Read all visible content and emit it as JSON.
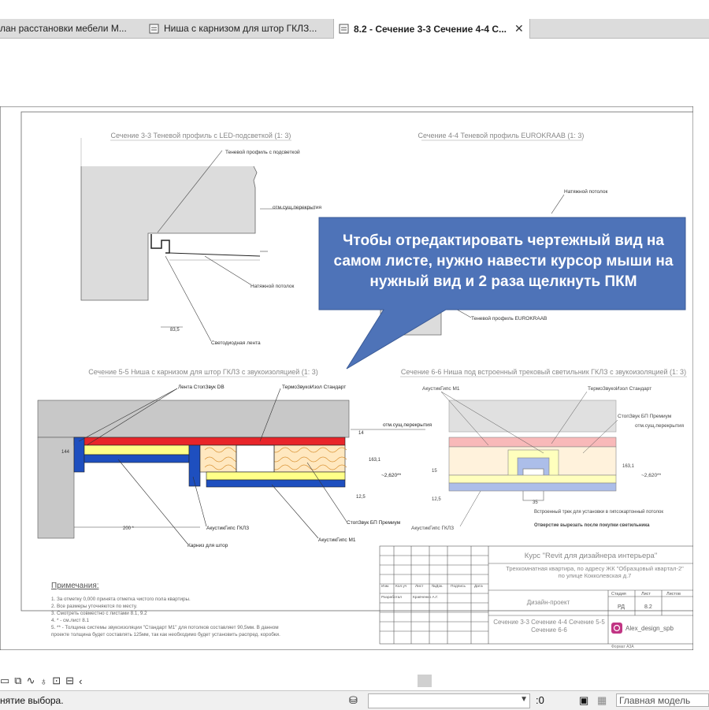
{
  "tabs": [
    {
      "label": "лан расстановки мебели М...",
      "active": false
    },
    {
      "label": "Ниша с карнизом для штор ГКЛЗ...",
      "active": false
    },
    {
      "label": "8.2 - Сечение 3-3 Сечение 4-4 С...",
      "active": true
    }
  ],
  "tab_close": "✕",
  "callout": "Чтобы отредактировать чертежный вид на самом листе, нужно навести курсор мыши на нужный вид и 2 раза щелкнуть ПКМ",
  "sheet": {
    "view1_title": "Сечение 3-3 Теневой профиль с LED-подсветкой (1: 3)",
    "view2_title": "Сечение 4-4 Теневой профиль EUROKRAAB (1: 3)",
    "view3_title": "Сечение 5-5 Ниша с карнизом для штор ГКЛЗ с звукоизоляцией (1: 3)",
    "view4_title": "Сечение 6-6 Ниша под встроенный трековый светильник ГКЛЗ с звукоизоляцией (1: 3)",
    "v1_labels": [
      "Теневой профиль с подсветкой",
      "отм.сущ.перекрытия",
      "Натяжной потолок",
      "Светодиодная лента"
    ],
    "v2_labels": [
      "Натяжной потолок",
      "Теневой профиль EUROKRAAB"
    ],
    "v3_labels": [
      "Лента СтопЗвук DB",
      "ТермоЗвукоИзол Стандарт",
      "отм.сущ.перекрытия",
      "СтопЗвук БП Премиум",
      "АкустикГипс ГКЛЗ",
      "АкустикГипс М1",
      "Карниз для штор",
      "~2,620**"
    ],
    "v4_labels": [
      "АкустикГипс М1",
      "ТермоЗвукоИзол Стандарт",
      "СтопЗвук БП Премиум",
      "отм.сущ.перекрытия",
      "АкустикГипс ГКЛЗ",
      "Встроенный трек для установки в гипсокартонный потолок",
      "Отверстие вырезать после покупки светильника",
      "~2,620**"
    ],
    "v1_dim": "83,5",
    "v3_dims": [
      "144",
      "14",
      "163,1",
      "12,5",
      "200 *"
    ],
    "v4_dims": [
      "15",
      "163,1",
      "12,5",
      "35",
      "~2,620**"
    ],
    "notes_title": "Примечания:",
    "notes": [
      "1.   За отметку 0,000 принята отметка чистого пола квартиры.",
      "2.   Все размеры уточняются по месту.",
      "3.   Смотреть совместно с листами 8.1, 9.2",
      "4.   * - см.лист 8.1",
      "5.   ** - Толщина системы звукоизоляции \"Стандарт М1\" для потолков составляет 90,5мм. В данном",
      "      проекте толщина будет составлять 125мм, так как необходимо будет установить распред. коробки."
    ],
    "stamp": {
      "course": "Курс \"Revit для дизайнера интерьера\"",
      "project": "Трехкомнатная квартира, по адресу ЖК \"Образцовый квартал-2\" по улице Кокколевская д.7",
      "hdr": [
        "Изм.",
        "Кол.уч",
        "Лист",
        "№Док.",
        "Подпись",
        "Дата"
      ],
      "developer_label": "Разработал",
      "developer_name": "Кравченко А.Г.",
      "design": "Дизайн-проект",
      "stage_hdr": "Стадия",
      "sheet_hdr": "Лист",
      "sheets_hdr": "Листов",
      "stage": "РД",
      "sheet_no": "8.2",
      "title": "Сечение 3-3 Сечение 4-4 Сечение 5-5 Сечение 6-6",
      "insta": "Alex_design_spb",
      "format": "Формат А3А"
    }
  },
  "status": {
    "text": "нятие выбора.",
    "filter": ":0",
    "model": "Главная модель"
  },
  "colors": {
    "callout_fill": "#4e73b8",
    "insulation_yellow": "#ffff88",
    "board_blue": "#1e4fbf",
    "red_layer": "#e8252a",
    "slab_gray": "#c8c8c8"
  }
}
